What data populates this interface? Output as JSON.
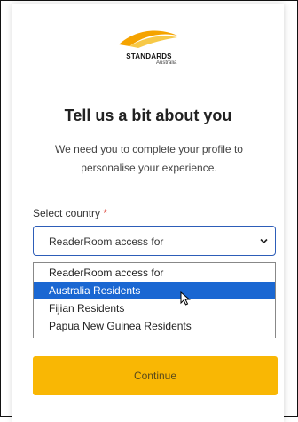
{
  "brand": {
    "name": "STANDARDS",
    "sub": "Australia"
  },
  "heading": "Tell us a bit about you",
  "subtext": "We need you to complete your profile to personalise your experience.",
  "country_field": {
    "label": "Select country",
    "required_mark": "*",
    "selected_value": "ReaderRoom access for"
  },
  "dropdown": {
    "options": [
      "ReaderRoom access for",
      "Australia Residents",
      "Fijian Residents",
      "Papua New Guinea Residents"
    ],
    "highlighted_index": 1
  },
  "continue_button": {
    "label": "Continue"
  },
  "colors": {
    "accent": "#f9b704",
    "select_border": "#2d5db8",
    "highlight": "#1a67d2",
    "required": "#d93025"
  }
}
